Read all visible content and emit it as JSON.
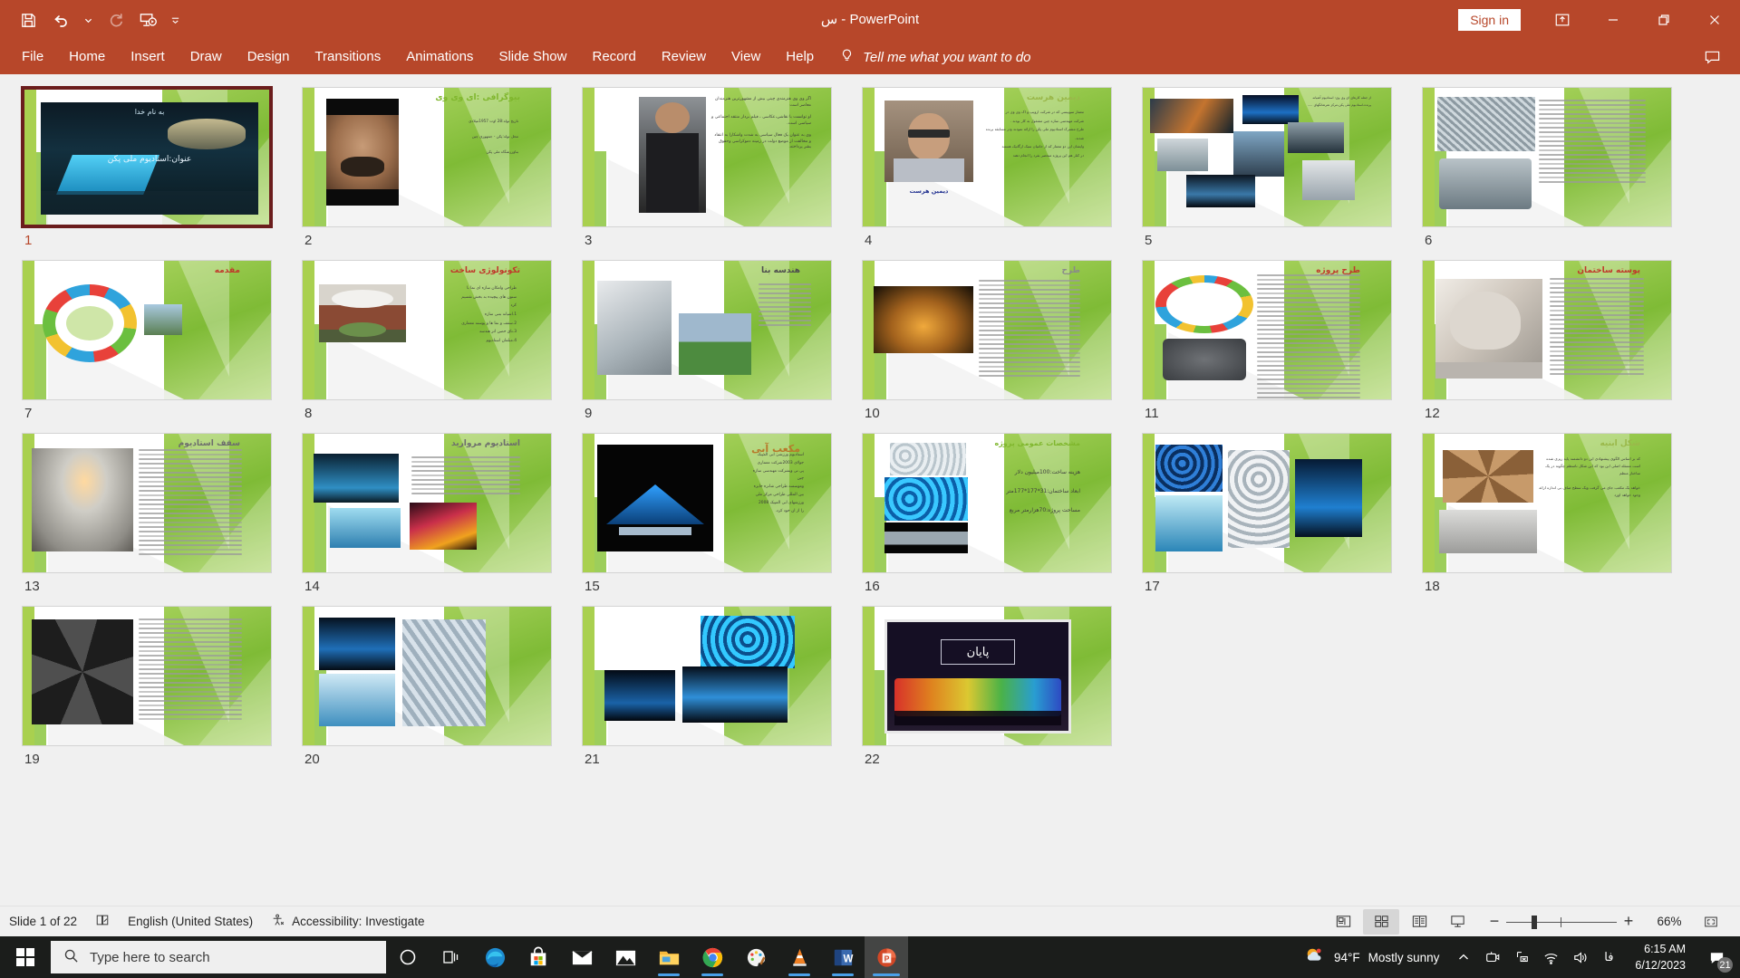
{
  "titlebar": {
    "title": "س  -  PowerPoint",
    "signin_label": "Sign in",
    "quick_access": [
      {
        "name": "save-button",
        "icon": "save-icon"
      },
      {
        "name": "undo-button",
        "icon": "undo-icon"
      },
      {
        "name": "undo-dropdown-button",
        "icon": "chevron-down-icon"
      },
      {
        "name": "redo-button",
        "icon": "redo-icon"
      },
      {
        "name": "start-from-beginning-button",
        "icon": "slideshow-icon"
      },
      {
        "name": "customize-quick-access-toolbar-button",
        "icon": "chevron-down-small-icon"
      }
    ],
    "window_controls": [
      {
        "name": "ribbon-display-options-button",
        "icon": "ribbon-options-icon"
      },
      {
        "name": "minimize-button",
        "icon": "minimize-icon"
      },
      {
        "name": "restore-button",
        "icon": "restore-icon"
      },
      {
        "name": "close-button",
        "icon": "close-icon"
      }
    ]
  },
  "ribbon": {
    "tabs": [
      "File",
      "Home",
      "Insert",
      "Draw",
      "Design",
      "Transitions",
      "Animations",
      "Slide Show",
      "Record",
      "Review",
      "View",
      "Help"
    ],
    "tell_me": "Tell me what you want to do",
    "tell_me_icon": "lightbulb-icon",
    "comments_icon": "comment-icon"
  },
  "statusbar": {
    "slide_counter": "Slide 1 of 22",
    "notes_icon": "notes-page-icon",
    "language": "English (United States)",
    "accessibility": "Accessibility: Investigate",
    "accessibility_icon": "accessibility-icon",
    "views": [
      {
        "name": "normal-view-button",
        "icon": "normal-view-icon",
        "active": false
      },
      {
        "name": "slide-sorter-view-button",
        "icon": "slide-sorter-icon",
        "active": true
      },
      {
        "name": "reading-view-button",
        "icon": "reading-view-icon",
        "active": false
      },
      {
        "name": "slide-show-view-button",
        "icon": "slideshow-view-icon",
        "active": false
      }
    ],
    "zoom_out_label": "−",
    "zoom_in_label": "+",
    "zoom_level": "66%",
    "fit_icon": "fit-to-window-icon"
  },
  "taskbar": {
    "search_placeholder": "Type here to search",
    "search_icon": "search-icon",
    "start_icon": "windows-start-icon",
    "apps": [
      {
        "name": "taskbar-cortana",
        "icon": "cortana-icon",
        "running": false,
        "active": false
      },
      {
        "name": "taskbar-task-view",
        "icon": "task-view-icon",
        "running": false,
        "active": false
      },
      {
        "name": "taskbar-edge",
        "icon": "edge-icon",
        "running": false,
        "active": false
      },
      {
        "name": "taskbar-microsoft-store",
        "icon": "store-icon",
        "running": false,
        "active": false
      },
      {
        "name": "taskbar-mail",
        "icon": "mail-icon",
        "running": false,
        "active": false
      },
      {
        "name": "taskbar-photos",
        "icon": "photos-icon",
        "running": false,
        "active": false
      },
      {
        "name": "taskbar-file-explorer",
        "icon": "folder-icon",
        "running": true,
        "active": false
      },
      {
        "name": "taskbar-chrome",
        "icon": "chrome-icon",
        "running": true,
        "active": false
      },
      {
        "name": "taskbar-paint",
        "icon": "paint-icon",
        "running": false,
        "active": false
      },
      {
        "name": "taskbar-vlc",
        "icon": "vlc-icon",
        "running": true,
        "active": false
      },
      {
        "name": "taskbar-word",
        "icon": "word-icon",
        "running": true,
        "active": false
      },
      {
        "name": "taskbar-powerpoint",
        "icon": "powerpoint-icon",
        "running": true,
        "active": true
      }
    ],
    "weather": {
      "temperature": "94°F",
      "condition": "Mostly sunny",
      "icon": "sun-cloud-icon"
    },
    "tray": [
      {
        "name": "show-hidden-icons-button",
        "icon": "chevron-up-icon"
      },
      {
        "name": "tray-camera-icon",
        "icon": "camera-icon"
      },
      {
        "name": "tray-network-disconnected",
        "icon": "network-error-icon"
      },
      {
        "name": "tray-wifi-icon",
        "icon": "wifi-icon"
      },
      {
        "name": "tray-volume-icon",
        "icon": "volume-icon"
      },
      {
        "name": "tray-language-icon",
        "icon": "language-farsi-icon"
      }
    ],
    "language_indicator": "فا",
    "clock": {
      "time": "6:15 AM",
      "date": "6/12/2023"
    },
    "notifications": {
      "icon": "action-center-icon",
      "count": "21"
    }
  },
  "colors": {
    "accent": "#b7472a",
    "theme_green": "#8cc63e",
    "selection": "#6b1d1d",
    "taskbar": "#1b1d1b"
  },
  "presentation": {
    "total_slides": 22,
    "selected_slide": 1,
    "slides": [
      {
        "number": "1",
        "title": "به نام خدا",
        "subtitle": "عنوان:استادیوم ملی پکن",
        "layout": "title-photo"
      },
      {
        "number": "2",
        "title": "بیوگرافی :ای وی وی",
        "layout": "portrait-left"
      },
      {
        "number": "3",
        "title": "",
        "layout": "portrait-center"
      },
      {
        "number": "4",
        "title": "دیمین هرست",
        "layout": "portrait-left-caption"
      },
      {
        "number": "5",
        "title": "",
        "layout": "photo-collage"
      },
      {
        "number": "6",
        "title": "",
        "layout": "two-photo-text"
      },
      {
        "number": "7",
        "title": "مقدمه",
        "layout": "diagram-photo"
      },
      {
        "number": "8",
        "title": "تکونولوژی ساخت",
        "layout": "photo-left-text"
      },
      {
        "number": "9",
        "title": "هندسه بنا",
        "layout": "two-photo-text"
      },
      {
        "number": "10",
        "title": "طرح",
        "layout": "photo-left-text"
      },
      {
        "number": "11",
        "title": "طرح پروژه",
        "layout": "diagram-dense-text"
      },
      {
        "number": "12",
        "title": "پوسته ساختمان",
        "layout": "photo-left-text"
      },
      {
        "number": "13",
        "title": "سقف استادیوم",
        "layout": "photo-left-dense"
      },
      {
        "number": "14",
        "title": "استادیوم مروارید",
        "layout": "three-photo-text"
      },
      {
        "number": "15",
        "title": "مکعب آبی",
        "layout": "photo-left-text"
      },
      {
        "number": "16",
        "title": "مشخصات عمومی پروژه",
        "layout": "specs"
      },
      {
        "number": "17",
        "title": "",
        "layout": "four-photo"
      },
      {
        "number": "18",
        "title": "شکل ابنیه",
        "layout": "two-photo-text"
      },
      {
        "number": "19",
        "title": "",
        "layout": "photo-left-dense"
      },
      {
        "number": "20",
        "title": "",
        "layout": "three-photo"
      },
      {
        "number": "21",
        "title": "",
        "layout": "three-photo-night"
      },
      {
        "number": "22",
        "title": "پایان",
        "layout": "closing"
      }
    ],
    "slide_16_specs": [
      "هزینه ساخت:100میلیون دلار",
      "ابعاد ساختمان:31*177*177متر",
      "مساحت پروژه:70هزارمتر مربع"
    ],
    "slide_15_body": "استادیوم مرکزی ابی المپیک 2008",
    "slide_2_body": [
      "تاریخ تولد:28 اوت 1957میلادی",
      "محل تولد:پکن - جمهوری چین",
      "بناورزشگاه ملی پکن"
    ]
  }
}
